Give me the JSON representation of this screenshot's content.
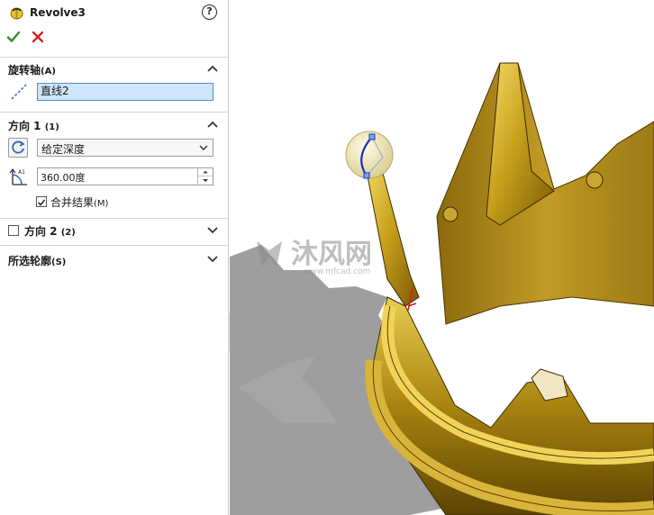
{
  "feature": {
    "title": "Revolve3",
    "help": "?"
  },
  "sections": {
    "axis": {
      "title": "旋转轴",
      "key": "(A)",
      "value": "直线2"
    },
    "direction1": {
      "title": "方向 1",
      "key": "(1)",
      "end_condition": "给定深度",
      "angle": "360.00度",
      "merge_label": "合并结果",
      "merge_key": "(M)",
      "merge_checked": true
    },
    "direction2": {
      "title": "方向 2",
      "key": "(2)",
      "checked": false
    },
    "contours": {
      "title": "所选轮廓",
      "key": "(S)"
    }
  },
  "watermark": {
    "brand": "沐风网",
    "url": "www.mfcad.com"
  },
  "colors": {
    "accent": "#4c8fd6",
    "field_bg": "#cfe5fa",
    "ok": "#2e8b22",
    "cancel": "#d42020",
    "gold": "#c9a21c"
  }
}
